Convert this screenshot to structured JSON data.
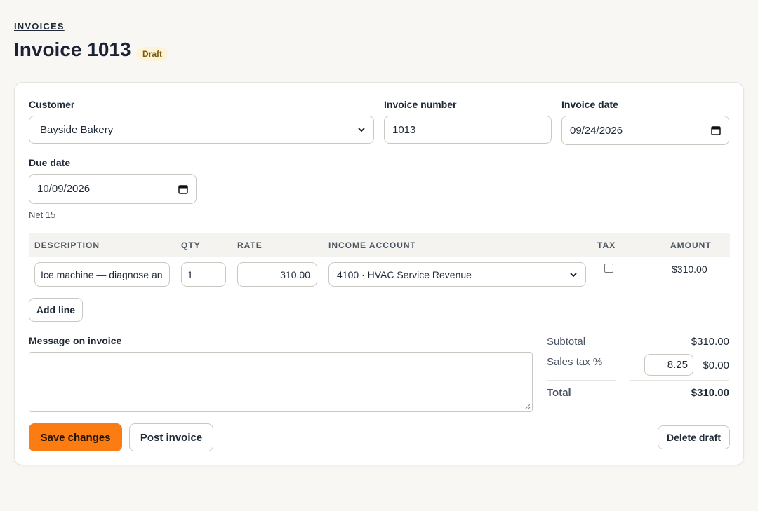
{
  "breadcrumb": "INVOICES",
  "page_title": "Invoice 1013",
  "status_badge": "Draft",
  "form": {
    "customer": {
      "label": "Customer",
      "value": "Bayside Bakery"
    },
    "invoice_number": {
      "label": "Invoice number",
      "value": "1013"
    },
    "invoice_date": {
      "label": "Invoice date",
      "value": "09/24/2026"
    },
    "due_date": {
      "label": "Due date",
      "value": "10/09/2026",
      "hint": "Net 15"
    }
  },
  "lines": {
    "headers": {
      "description": "DESCRIPTION",
      "qty": "QTY",
      "rate": "RATE",
      "account": "INCOME ACCOUNT",
      "tax": "TAX",
      "amount": "AMOUNT"
    },
    "rows": [
      {
        "description": "Ice machine — diagnose an",
        "qty": "1",
        "rate": "310.00",
        "account": "4100 · HVAC Service Revenue",
        "tax": false,
        "amount": "$310.00"
      }
    ],
    "add_line_label": "Add line"
  },
  "message": {
    "label": "Message on invoice",
    "value": ""
  },
  "totals": {
    "subtotal_label": "Subtotal",
    "subtotal": "$310.00",
    "tax_label": "Sales tax %",
    "tax_rate": "8.25",
    "tax_amount": "$0.00",
    "total_label": "Total",
    "total": "$310.00"
  },
  "actions": {
    "save": "Save changes",
    "post": "Post invoice",
    "delete": "Delete draft"
  },
  "colors": {
    "primary_button": "#fb7c12",
    "badge_bg": "#fdf3d6",
    "badge_text": "#7a5b14",
    "page_bg": "#f8f7f4"
  },
  "icons": {
    "select_arrow": "chevron-down-icon",
    "date_picker": "calendar-icon"
  }
}
